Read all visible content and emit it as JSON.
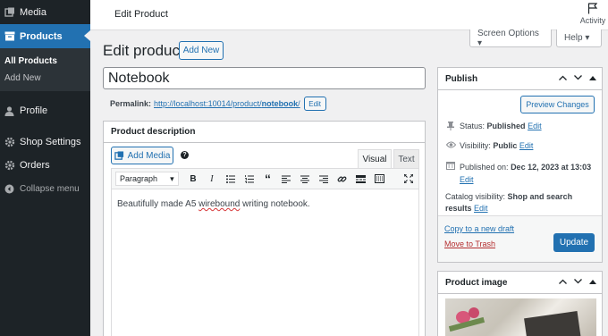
{
  "sidebar": {
    "media": "Media",
    "products": "Products",
    "submenu": [
      "All Products",
      "Add New"
    ],
    "profile": "Profile",
    "shop_settings": "Shop Settings",
    "orders": "Orders",
    "collapse": "Collapse menu"
  },
  "topbar": {
    "title": "Edit Product",
    "activity": "Activity"
  },
  "screen_options": "Screen Options ▾",
  "help": "Help ▾",
  "page": {
    "title": "Edit product",
    "add_new": "Add New",
    "product_title": "Notebook",
    "permalink_label": "Permalink:",
    "permalink_base": "http://localhost:10014/product/",
    "permalink_slug": "notebook",
    "permalink_trail": "/",
    "permalink_edit": "Edit"
  },
  "description": {
    "heading": "Product description",
    "add_media": "Add Media",
    "tab_visual": "Visual",
    "tab_text": "Text",
    "format": "Paragraph",
    "content_a": "Beautifully made A5 ",
    "content_b": "wirebound",
    "content_c": " writing notebook."
  },
  "publish": {
    "heading": "Publish",
    "preview": "Preview Changes",
    "status_label": "Status:",
    "status_value": "Published",
    "visibility_label": "Visibility:",
    "visibility_value": "Public",
    "published_label": "Published on:",
    "published_value": "Dec 12, 2023 at 13:03",
    "catalog_label": "Catalog visibility:",
    "catalog_value": "Shop and search results",
    "edit": "Edit",
    "copy_draft": "Copy to a new draft",
    "trash": "Move to Trash",
    "update": "Update"
  },
  "product_image": {
    "heading": "Product image"
  },
  "colors": {
    "accent": "#2271b1",
    "sidebar": "#1d2327",
    "trash": "#b32d2e"
  }
}
